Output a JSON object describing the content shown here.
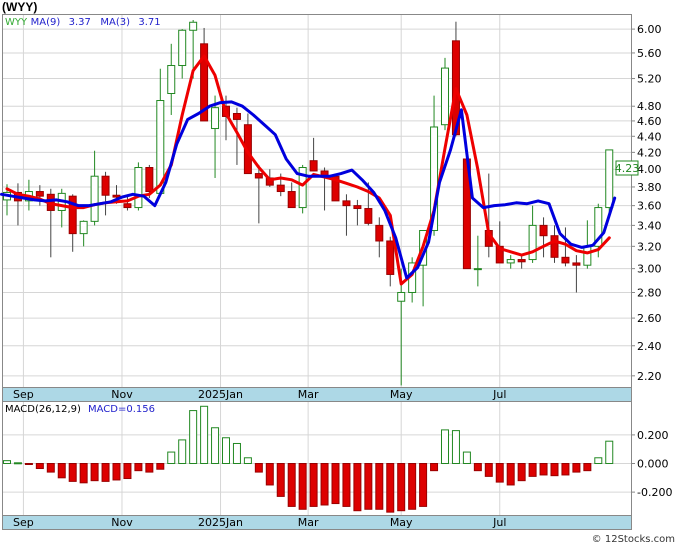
{
  "page": {
    "title": "(WYY)",
    "footer": "© 12Stocks.com"
  },
  "chart_data": [
    {
      "type": "candlestick",
      "ticker": "WYY",
      "legend": [
        {
          "text": "WYY",
          "color": "#33aa33"
        },
        {
          "text": "MA(9)",
          "color": "#2222cc"
        },
        {
          "text": "3.37",
          "color": "#2222cc"
        },
        {
          "text": "MA(3)",
          "color": "#2222cc"
        },
        {
          "text": "3.71",
          "color": "#2222cc"
        }
      ],
      "last_price_label": "4.23",
      "yscale": "log",
      "ylim": [
        2.13,
        6.25
      ],
      "yticks": [
        "6.00",
        "5.60",
        "5.20",
        "4.80",
        "4.60",
        "4.40",
        "4.20",
        "4.00",
        "3.80",
        "3.60",
        "3.40",
        "3.20",
        "3.00",
        "2.80",
        "2.60",
        "2.40",
        "2.20"
      ],
      "xlabels": [
        {
          "label": "Sep",
          "i": 1.5
        },
        {
          "label": "Nov",
          "i": 10.5
        },
        {
          "label": "2025Jan",
          "i": 19.5
        },
        {
          "label": "Mar",
          "i": 27.5
        },
        {
          "label": "May",
          "i": 36
        },
        {
          "label": "Jul",
          "i": 45
        }
      ],
      "colors": {
        "up": "#228822",
        "down": "#dd0000",
        "ma_fast": "#ee0000",
        "ma_slow": "#0000dd",
        "axis_band": "#add8e6"
      },
      "ohlc": [
        [
          3.66,
          3.83,
          3.5,
          3.74
        ],
        [
          3.74,
          3.84,
          3.4,
          3.65
        ],
        [
          3.65,
          3.88,
          3.55,
          3.75
        ],
        [
          3.75,
          3.82,
          3.6,
          3.7
        ],
        [
          3.72,
          3.78,
          3.1,
          3.55
        ],
        [
          3.55,
          3.78,
          3.38,
          3.73
        ],
        [
          3.7,
          3.72,
          3.15,
          3.32
        ],
        [
          3.32,
          3.45,
          3.2,
          3.44
        ],
        [
          3.44,
          4.22,
          3.4,
          3.92
        ],
        [
          3.92,
          3.97,
          3.5,
          3.71
        ],
        [
          3.71,
          3.82,
          3.62,
          3.69
        ],
        [
          3.62,
          3.7,
          3.55,
          3.58
        ],
        [
          3.58,
          4.08,
          3.55,
          4.02
        ],
        [
          4.02,
          4.05,
          3.68,
          3.75
        ],
        [
          3.73,
          5.35,
          3.7,
          4.88
        ],
        [
          4.98,
          5.75,
          4.68,
          5.4
        ],
        [
          5.4,
          6.0,
          5.2,
          5.98
        ],
        [
          5.98,
          6.16,
          5.2,
          6.12
        ],
        [
          5.75,
          6.02,
          4.65,
          4.6
        ],
        [
          4.5,
          4.95,
          3.9,
          4.78
        ],
        [
          4.8,
          4.95,
          4.35,
          4.66
        ],
        [
          4.7,
          4.78,
          4.05,
          4.62
        ],
        [
          4.55,
          4.7,
          4.4,
          3.95
        ],
        [
          3.95,
          4.05,
          3.42,
          3.9
        ],
        [
          3.9,
          4.0,
          3.8,
          3.82
        ],
        [
          3.82,
          3.95,
          3.7,
          3.75
        ],
        [
          3.75,
          3.85,
          3.63,
          3.58
        ],
        [
          3.58,
          4.05,
          3.52,
          4.02
        ],
        [
          4.1,
          4.38,
          4.0,
          3.98
        ],
        [
          3.98,
          4.02,
          3.55,
          3.92
        ],
        [
          3.92,
          3.95,
          3.65,
          3.65
        ],
        [
          3.65,
          3.72,
          3.3,
          3.6
        ],
        [
          3.6,
          3.66,
          3.4,
          3.57
        ],
        [
          3.57,
          3.85,
          3.4,
          3.42
        ],
        [
          3.4,
          3.48,
          3.1,
          3.25
        ],
        [
          3.25,
          3.29,
          2.85,
          2.95
        ],
        [
          2.73,
          3.0,
          2.14,
          2.8
        ],
        [
          2.8,
          3.1,
          2.72,
          3.05
        ],
        [
          3.03,
          3.33,
          2.69,
          3.35
        ],
        [
          3.35,
          4.95,
          3.3,
          4.52
        ],
        [
          4.55,
          5.52,
          4.48,
          5.36
        ],
        [
          5.8,
          6.13,
          4.4,
          4.42
        ],
        [
          4.12,
          4.18,
          3.0,
          3.0
        ],
        [
          3.0,
          3.3,
          2.85,
          3.0
        ],
        [
          3.35,
          3.95,
          3.1,
          3.2
        ],
        [
          3.2,
          3.44,
          3.05,
          3.05
        ],
        [
          3.05,
          3.12,
          3.0,
          3.08
        ],
        [
          3.08,
          3.12,
          3.0,
          3.06
        ],
        [
          3.08,
          3.6,
          3.05,
          3.4
        ],
        [
          3.4,
          3.48,
          3.1,
          3.3
        ],
        [
          3.3,
          3.4,
          3.05,
          3.1
        ],
        [
          3.1,
          3.38,
          3.02,
          3.05
        ],
        [
          3.05,
          3.12,
          2.8,
          3.03
        ],
        [
          3.03,
          3.45,
          3.0,
          3.2
        ],
        [
          3.2,
          3.62,
          3.1,
          3.58
        ],
        [
          3.58,
          4.12,
          3.52,
          4.23
        ]
      ],
      "ma_fast": [
        3.78,
        3.72,
        3.7,
        3.67,
        3.62,
        3.6,
        3.58,
        3.58,
        3.61,
        3.63,
        3.64,
        3.65,
        3.7,
        3.72,
        3.82,
        4.05,
        4.68,
        5.32,
        5.55,
        5.25,
        4.7,
        4.45,
        4.2,
        4.02,
        3.88,
        3.9,
        3.88,
        3.82,
        3.94,
        3.91,
        3.88,
        3.84,
        3.8,
        3.75,
        3.68,
        3.5,
        2.87,
        2.95,
        3.2,
        3.55,
        4.25,
        5.05,
        4.68,
        4.0,
        3.32,
        3.18,
        3.15,
        3.12,
        3.15,
        3.2,
        3.25,
        3.22,
        3.16,
        3.14,
        3.17,
        3.28
      ],
      "ma_slow": [
        3.72,
        3.7,
        3.68,
        3.66,
        3.65,
        3.66,
        3.64,
        3.6,
        3.6,
        3.62,
        3.64,
        3.69,
        3.72,
        3.7,
        3.6,
        3.85,
        4.3,
        4.62,
        4.7,
        4.8,
        4.85,
        4.86,
        4.8,
        4.68,
        4.55,
        4.42,
        4.12,
        3.95,
        3.92,
        3.92,
        3.92,
        3.95,
        3.99,
        3.87,
        3.74,
        3.55,
        3.28,
        2.92,
        3.01,
        3.24,
        3.85,
        4.23,
        4.75,
        3.68,
        3.58,
        3.6,
        3.61,
        3.63,
        3.62,
        3.65,
        3.62,
        3.32,
        3.22,
        3.19,
        3.21,
        3.33,
        3.68
      ],
      "ma_slow_start": -0.5
    },
    {
      "type": "bar",
      "title": "MACD(26,12,9)",
      "value_label": "MACD=0.156",
      "yticks": [
        0.2,
        0.0,
        -0.2
      ],
      "ytick_labels": [
        "0.200",
        "0.000",
        "-0.200"
      ],
      "ylim": [
        -0.36,
        0.43
      ],
      "values": [
        0.02,
        0.005,
        -0.005,
        -0.035,
        -0.06,
        -0.1,
        -0.125,
        -0.135,
        -0.12,
        -0.125,
        -0.115,
        -0.105,
        -0.05,
        -0.06,
        -0.04,
        0.08,
        0.165,
        0.37,
        0.4,
        0.25,
        0.18,
        0.14,
        0.04,
        -0.06,
        -0.15,
        -0.23,
        -0.3,
        -0.32,
        -0.3,
        -0.29,
        -0.28,
        -0.3,
        -0.33,
        -0.32,
        -0.32,
        -0.34,
        -0.33,
        -0.32,
        -0.3,
        -0.05,
        0.235,
        0.23,
        0.08,
        -0.05,
        -0.09,
        -0.13,
        -0.15,
        -0.12,
        -0.09,
        -0.08,
        -0.085,
        -0.08,
        -0.06,
        -0.05,
        0.04,
        0.156
      ]
    }
  ]
}
